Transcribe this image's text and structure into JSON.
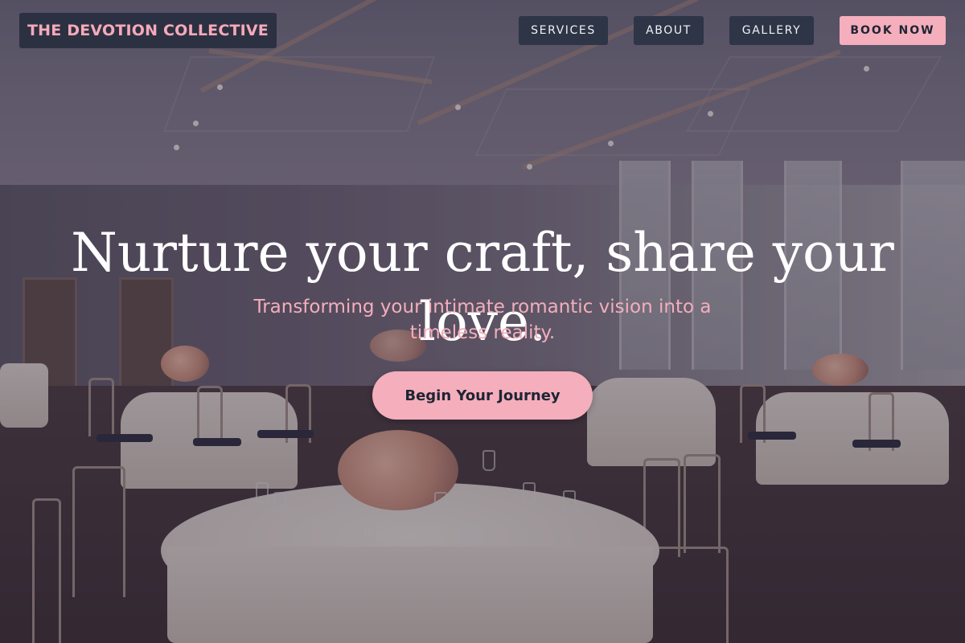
{
  "header": {
    "brand": "THE DEVOTION COLLECTIVE",
    "nav": {
      "services": "SERVICES",
      "about": "ABOUT",
      "gallery": "GALLERY",
      "book_now": "BOOK NOW"
    }
  },
  "hero": {
    "title": "Nurture your craft, share your love.",
    "subtitle": "Transforming your intimate romantic vision into a timeless reality.",
    "cta_label": "Begin Your Journey"
  },
  "background": {
    "subject": "wedding-banquet-hall-photo"
  },
  "colors": {
    "accent_pink": "#f4aebc",
    "nav_dark": "#2d3547",
    "text_dark": "#1f2433"
  }
}
